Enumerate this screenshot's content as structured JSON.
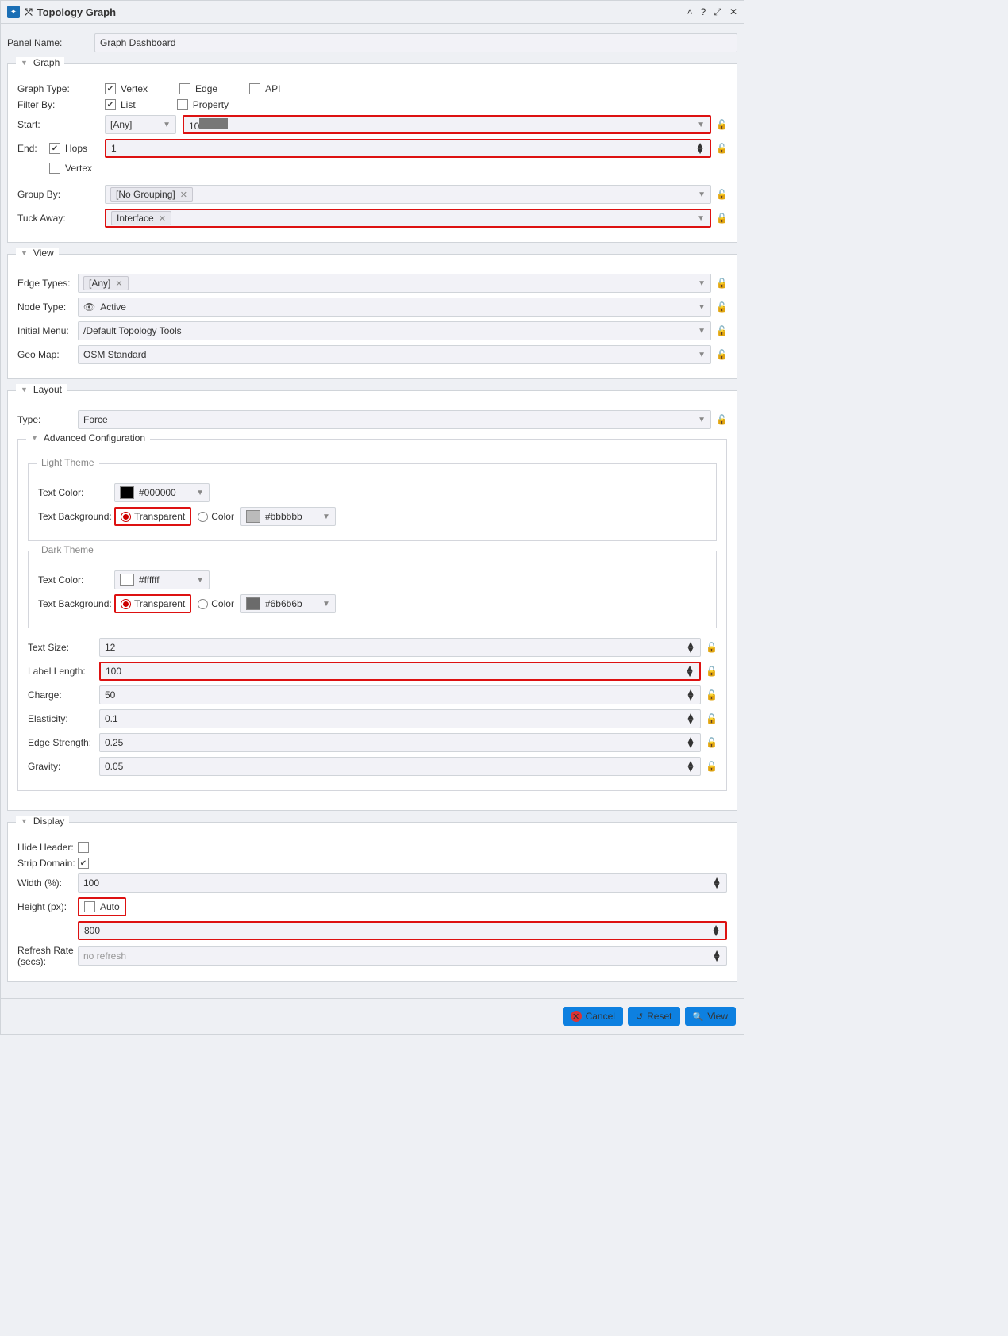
{
  "header": {
    "title": "Topology Graph"
  },
  "panelName": {
    "label": "Panel Name:",
    "value": "Graph Dashboard"
  },
  "sections": {
    "graph": {
      "title": "Graph",
      "graphType": {
        "label": "Graph Type:",
        "vertex": "Vertex",
        "edge": "Edge",
        "api": "API"
      },
      "filterBy": {
        "label": "Filter By:",
        "list": "List",
        "property": "Property"
      },
      "start": {
        "label": "Start:",
        "typeValue": "[Any]",
        "inputPrefix": "10"
      },
      "end": {
        "label": "End:",
        "hops": "Hops",
        "hopsValue": "1",
        "vertex": "Vertex"
      },
      "groupBy": {
        "label": "Group By:",
        "tag": "[No Grouping]"
      },
      "tuckAway": {
        "label": "Tuck Away:",
        "tag": "Interface"
      }
    },
    "view": {
      "title": "View",
      "edgeTypes": {
        "label": "Edge Types:",
        "tag": "[Any]"
      },
      "nodeType": {
        "label": "Node Type:",
        "value": "Active"
      },
      "initialMenu": {
        "label": "Initial Menu:",
        "value": "/Default Topology Tools"
      },
      "geoMap": {
        "label": "Geo Map:",
        "value": "OSM Standard"
      }
    },
    "layout": {
      "title": "Layout",
      "type": {
        "label": "Type:",
        "value": "Force"
      },
      "advanced": {
        "title": "Advanced Configuration",
        "lightTheme": {
          "title": "Light Theme",
          "textColorLabel": "Text Color:",
          "textColor": "#000000",
          "bgLabel": "Text Background:",
          "transparent": "Transparent",
          "color": "Color",
          "colorValue": "#bbbbbb"
        },
        "darkTheme": {
          "title": "Dark Theme",
          "textColorLabel": "Text Color:",
          "textColor": "#ffffff",
          "bgLabel": "Text Background:",
          "transparent": "Transparent",
          "color": "Color",
          "colorValue": "#6b6b6b"
        },
        "textSize": {
          "label": "Text Size:",
          "value": "12"
        },
        "labelLength": {
          "label": "Label Length:",
          "value": "100"
        },
        "charge": {
          "label": "Charge:",
          "value": "50"
        },
        "elasticity": {
          "label": "Elasticity:",
          "value": "0.1"
        },
        "edgeStrength": {
          "label": "Edge Strength:",
          "value": "0.25"
        },
        "gravity": {
          "label": "Gravity:",
          "value": "0.05"
        }
      }
    },
    "display": {
      "title": "Display",
      "hideHeader": {
        "label": "Hide Header:"
      },
      "stripDomain": {
        "label": "Strip Domain:"
      },
      "width": {
        "label": "Width (%):",
        "value": "100"
      },
      "height": {
        "label": "Height (px):",
        "auto": "Auto",
        "value": "800"
      },
      "refresh": {
        "label": "Refresh Rate (secs):",
        "value": "no refresh"
      }
    }
  },
  "footer": {
    "cancel": "Cancel",
    "reset": "Reset",
    "view": "View"
  }
}
